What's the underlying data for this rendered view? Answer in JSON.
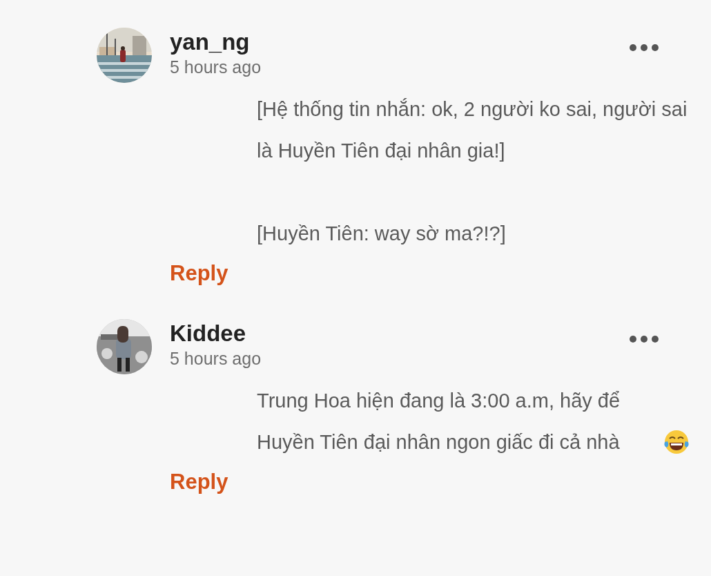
{
  "comments": [
    {
      "author": "yan_ng",
      "time": "5 hours ago",
      "avatar": {
        "kind": "picture"
      },
      "paragraphs": [
        {
          "text": "[Hệ thống tin nhắn: ok, 2 người ko sai, người sai là Huyền Tiên đại nhân gia!]"
        },
        {
          "text": "[Huyền Tiên: way sờ ma?!?]"
        }
      ],
      "reply": "Reply"
    },
    {
      "author": "Kiddee",
      "time": "5 hours ago",
      "avatar": {
        "kind": "picture"
      },
      "paragraphs": [
        {
          "text": "Trung Hoa hiện đang là 3:00 a.m, hãy để Huyền Tiên đại nhân ngon giấc đi cả nhà",
          "trailing_emoji": true
        }
      ],
      "reply": "Reply"
    }
  ]
}
